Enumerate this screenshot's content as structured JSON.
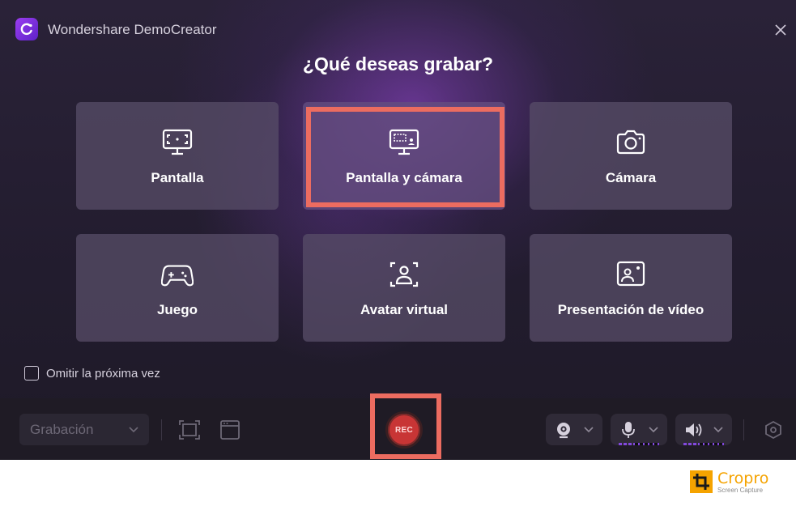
{
  "window": {
    "app_title": "Wondershare DemoCreator",
    "heading": "¿Qué deseas grabar?",
    "accent_color": "#8c4cf0",
    "highlight_color": "#ec6c60"
  },
  "options": [
    {
      "label": "Pantalla",
      "icon": "screen-capture-icon"
    },
    {
      "label": "Pantalla y cámara",
      "icon": "screen-camera-icon"
    },
    {
      "label": "Cámara",
      "icon": "camera-icon"
    },
    {
      "label": "Juego",
      "icon": "gamepad-icon"
    },
    {
      "label": "Avatar virtual",
      "icon": "avatar-icon"
    },
    {
      "label": "Presentación de vídeo",
      "icon": "video-presentation-icon"
    }
  ],
  "skip_next_time": {
    "label": "Omitir la próxima vez",
    "checked": false
  },
  "bottombar": {
    "mode_value": "Grabación",
    "rec_label": "REC",
    "rec_color": "#c83535"
  },
  "branding": {
    "name": "Cropro",
    "tagline": "Screen Capture",
    "color": "#f5a300"
  }
}
